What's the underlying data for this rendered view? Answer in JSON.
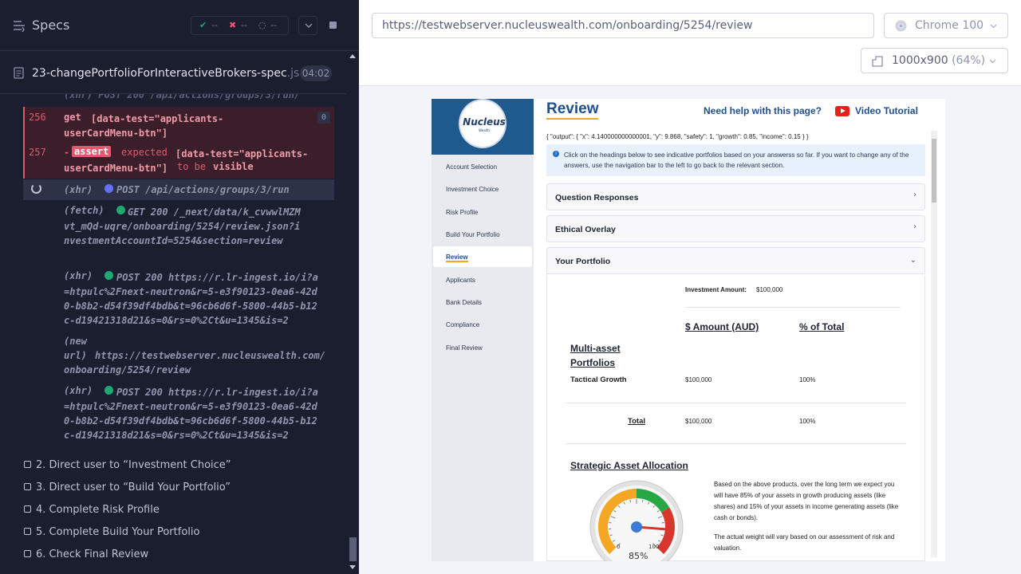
{
  "reporter": {
    "title": "Specs",
    "stats": {
      "passed": "--",
      "failed": "--",
      "pending": "--"
    },
    "spec_file": "23-changePortfolioForInteractiveBrokers-spec",
    "spec_ext": ".js",
    "duration": "04:02",
    "log": {
      "partial_line": "(xhr)  POST 200 /api/actions/groups/3/run/",
      "cmd256_num": "256",
      "cmd256_name": "get",
      "cmd256_arg": "[data-test=\"applicants-userCardMenu-btn\"]",
      "cmd256_count": "0",
      "cmd257_num": "257",
      "cmd257_prefix": "-",
      "cmd257_name": "assert",
      "cmd257_text1": "expected",
      "cmd257_arg": "[data-test=\"applicants-userCardMenu-btn\"]",
      "cmd257_text2": "to be",
      "cmd257_text3": "visible",
      "xhr_pending_type": "(xhr)",
      "xhr_pending_text": "POST /api/actions/groups/3/run",
      "fetch_type": "(fetch)",
      "fetch_text": "GET 200 /_next/data/k_cvwwlMZMvt_mQd-uqre/onboarding/5254/review.json?investmentAccountId=5254&section=review",
      "xhr1_type": "(xhr)",
      "xhr1_text": "POST 200 https://r.lr-ingest.io/i?a=htpulc%2Fnext-neutron&r=5-e3f90123-0ea6-42d0-b8b2-d54f39df4bdb&t=96cb6d6f-5800-44b5-b12c-d19421318d21&s=0&rs=0%2Ct&u=1345&is=2",
      "newurl_type": "(new url)",
      "newurl_text": "https://testwebserver.nucleuswealth.com/onboarding/5254/review",
      "xhr2_type": "(xhr)",
      "xhr2_text": "POST 200 https://r.lr-ingest.io/i?a=htpulc%2Fnext-neutron&r=5-e3f90123-0ea6-42d0-b8b2-d54f39df4bdb&t=96cb6d6f-5800-44b5-b12c-d19421318d21&s=0&rs=0%2Ct&u=1345&is=2"
    },
    "tests": [
      "2. Direct user to “Investment Choice”",
      "3. Direct user to “Build Your Portfolio”",
      "4. Complete Risk Profile",
      "5. Complete Build Your Portfolio",
      "6. Check Final Review"
    ]
  },
  "aut": {
    "url": "https://testwebserver.nucleuswealth.com/onboarding/5254/review",
    "browser": "Chrome 100",
    "viewport": "1000x900",
    "scale": "(64%)"
  },
  "app": {
    "logo": "Nucleus",
    "logo_sub": "Wealth",
    "nav": [
      "Account Selection",
      "Investment Choice",
      "Risk Profile",
      "Build Your Portfolio",
      "Review",
      "Applicants",
      "Bank Details",
      "Compliance",
      "Final Review"
    ],
    "title": "Review",
    "help": "Need help with this page?",
    "video": "Video Tutorial",
    "output": "{ \"output\": { \"x\": 4.140000000000001, \"y\": 9.868, \"safety\": 1, \"growth\": 0.85, \"income\": 0.15 } }",
    "info": "Click on the headings below to see indicative portfolios based on your answerss so far. If you want to change any of the answers, use the navigation bar to the left to go back to the relevant section.",
    "accordions": [
      "Question Responses",
      "Ethical Overlay",
      "Your Portfolio"
    ],
    "investment_label": "Investment Amount:",
    "investment_value": "$100,000",
    "col_amount": "$ Amount (AUD)",
    "col_pct": "% of Total",
    "multi_asset": "Multi-asset Portfolios",
    "row_name": "Tactical Growth",
    "row_amount": "$100,000",
    "row_pct": "100%",
    "total_label": "Total",
    "total_amount": "$100,000",
    "total_pct": "100%",
    "saa": "Strategic Asset Allocation",
    "saa_text1": "Based on the above products, over the long term we expect you will have 85% of your assets in growth producing assets (like shares) and 15% of your assets in income generating assets (like cash or bonds).",
    "saa_text2": "The actual weight will vary based on our assessment of risk and valuation.",
    "gauge_min": "0",
    "gauge_max": "100",
    "gauge_value": "85%",
    "gauge_level": 85
  }
}
